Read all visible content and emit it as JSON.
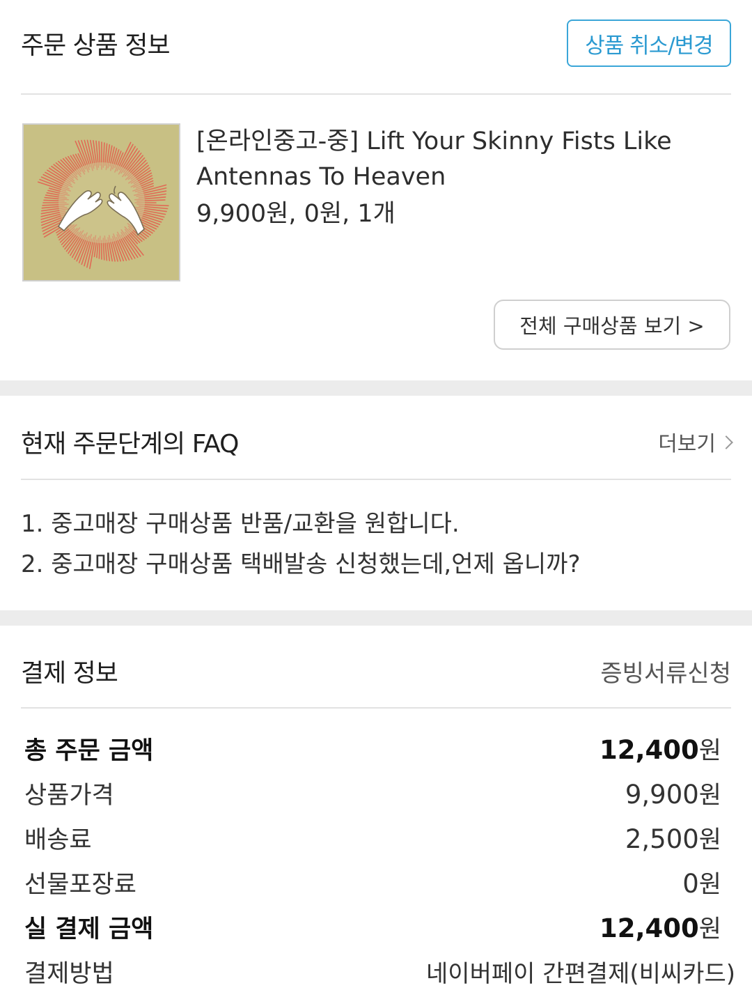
{
  "order": {
    "title": "주문 상품 정보",
    "cancel_button": "상품 취소/변경",
    "product": {
      "title": "[온라인중고-중] Lift Your Skinny Fists Like Antennas To Heaven",
      "price_line": "9,900원, 0원, 1개"
    },
    "all_items_button": "전체 구매상품 보기 >"
  },
  "faq": {
    "title": "현재 주문단계의 FAQ",
    "more_label": "더보기",
    "items": [
      "1. 중고매장 구매상품 반품/교환을 원합니다.",
      "2. 중고매장 구매상품 택배발송 신청했는데,언제 옵니까?"
    ]
  },
  "payment": {
    "title": "결제 정보",
    "doc_link": "증빙서류신청",
    "currency": "원",
    "rows": [
      {
        "label": "총 주문 금액",
        "value": "12,400"
      },
      {
        "label": "상품가격",
        "value": "9,900"
      },
      {
        "label": "배송료",
        "value": "2,500"
      },
      {
        "label": "선물포장료",
        "value": "0"
      },
      {
        "label": "실 결제 금액",
        "value": "12,400"
      }
    ],
    "method_label": "결제방법",
    "method_value": "네이버페이 간편결제(비씨카드)"
  },
  "colors": {
    "accent_blue": "#2b9ad1",
    "pay_pink": "#d8467a",
    "gap_gray": "#ececec"
  }
}
